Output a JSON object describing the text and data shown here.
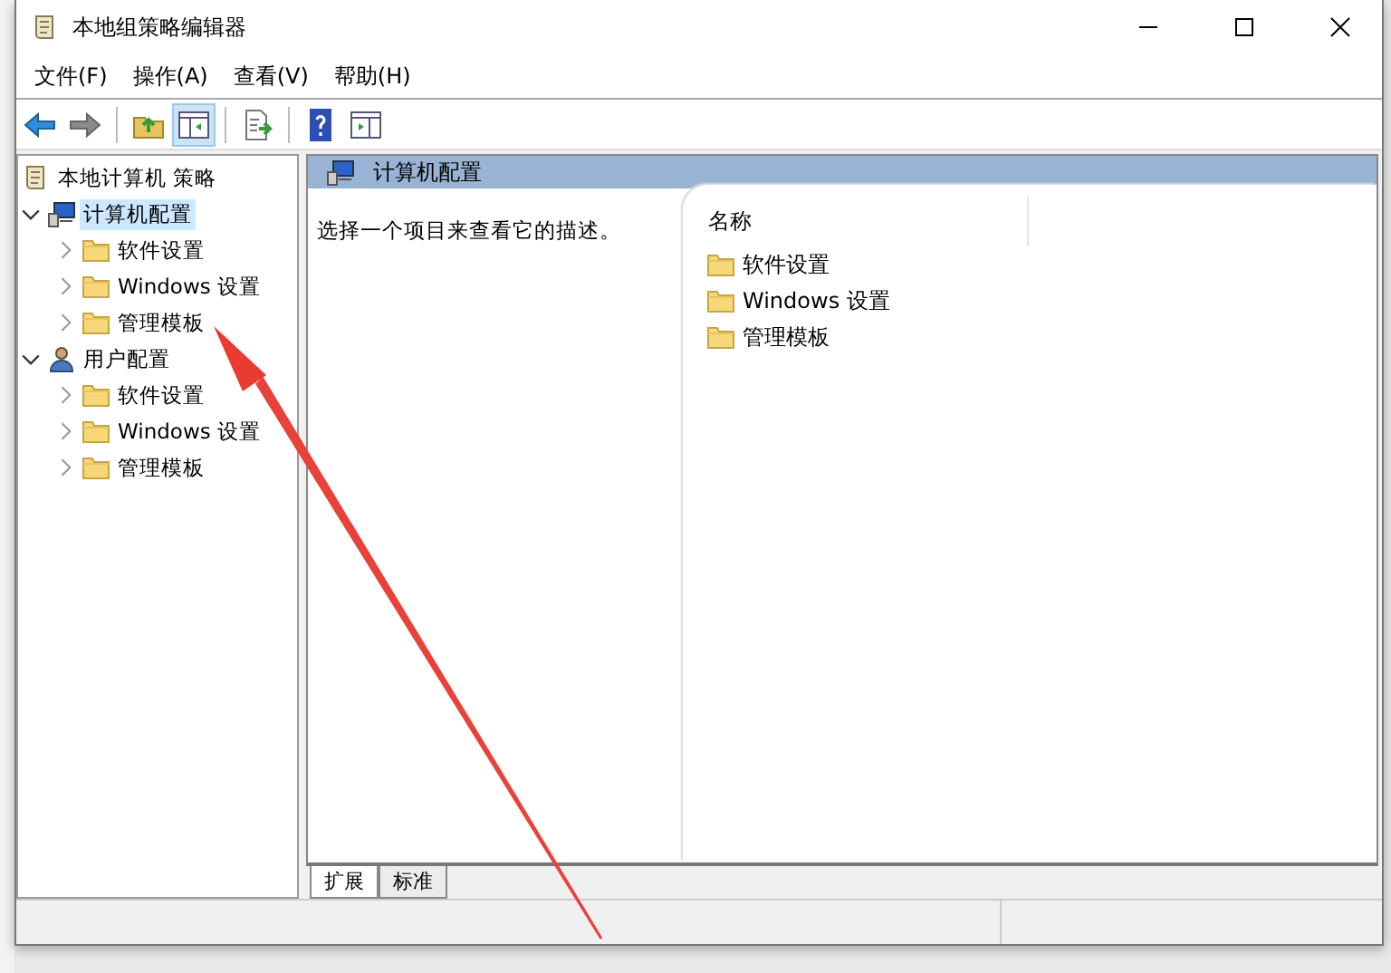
{
  "window": {
    "title": "本地组策略编辑器"
  },
  "menu": [
    "文件(F)",
    "操作(A)",
    "查看(V)",
    "帮助(H)"
  ],
  "tree": {
    "label": "本地计算机 策略",
    "children": [
      {
        "label": "计算机配置",
        "kind": "computer",
        "expanded": true,
        "selected": true,
        "children": [
          {
            "label": "软件设置",
            "kind": "folder",
            "expanded": false,
            "selected": false
          },
          {
            "label": "Windows 设置",
            "kind": "folder",
            "expanded": false,
            "selected": false
          },
          {
            "label": "管理模板",
            "kind": "folder",
            "expanded": false,
            "selected": false
          }
        ]
      },
      {
        "label": "用户配置",
        "kind": "user",
        "expanded": true,
        "selected": false,
        "children": [
          {
            "label": "软件设置",
            "kind": "folder",
            "expanded": false,
            "selected": false
          },
          {
            "label": "Windows 设置",
            "kind": "folder",
            "expanded": false,
            "selected": false
          },
          {
            "label": "管理模板",
            "kind": "folder",
            "expanded": false,
            "selected": false
          }
        ]
      }
    ]
  },
  "details": {
    "header": "计算机配置",
    "description": "选择一个项目来查看它的描述。",
    "column": "名称",
    "items": [
      "软件设置",
      "Windows 设置",
      "管理模板"
    ]
  },
  "view_tabs": [
    {
      "label": "扩展",
      "selected": true
    },
    {
      "label": "标准",
      "selected": false
    }
  ]
}
